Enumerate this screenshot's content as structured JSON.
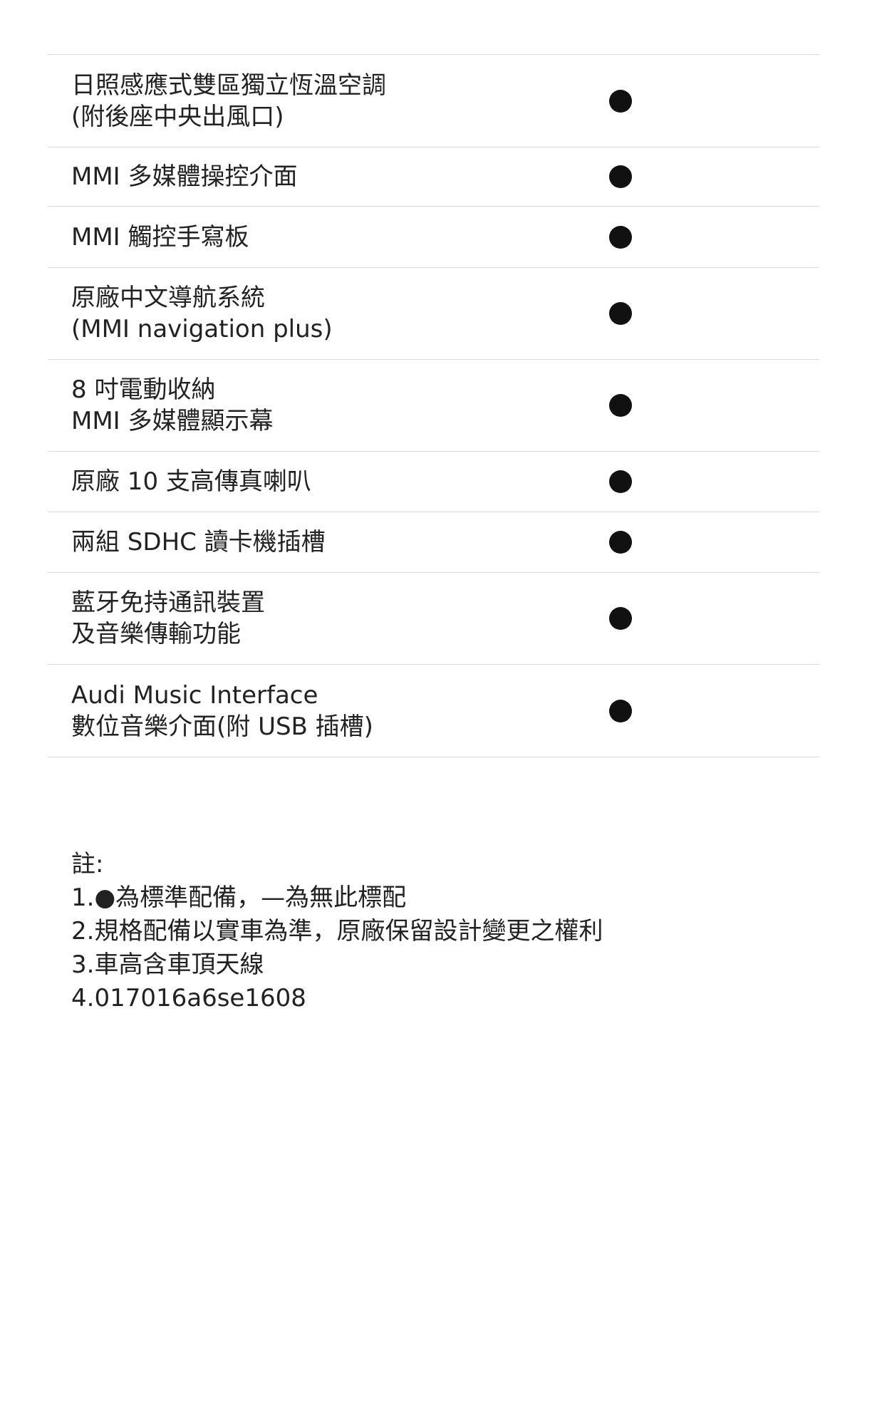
{
  "features": [
    {
      "label": "日照感應式雙區獨立恆溫空調\n(附後座中央出風口)",
      "standard": true
    },
    {
      "label": "MMI 多媒體操控介面",
      "standard": true
    },
    {
      "label": "MMI 觸控手寫板",
      "standard": true
    },
    {
      "label": "原廠中文導航系統\n(MMI navigation plus)",
      "standard": true
    },
    {
      "label": "8 吋電動收納\nMMI 多媒體顯示幕",
      "standard": true
    },
    {
      "label": "原廠 10 支高傳真喇叭",
      "standard": true
    },
    {
      "label": "兩組 SDHC 讀卡機插槽",
      "standard": true
    },
    {
      "label": "藍牙免持通訊裝置\n及音樂傳輸功能",
      "standard": true
    },
    {
      "label": "Audi Music Interface\n數位音樂介面(附 USB 插槽)",
      "standard": true
    }
  ],
  "notes": {
    "title": "註:",
    "lines": [
      "1.●為標準配備，—為無此標配",
      "2.規格配備以實車為準，原廠保留設計變更之權利",
      "3.車高含車頂天線",
      "4.017016a6se1608"
    ]
  },
  "mark_icon": "filled-circle-icon"
}
